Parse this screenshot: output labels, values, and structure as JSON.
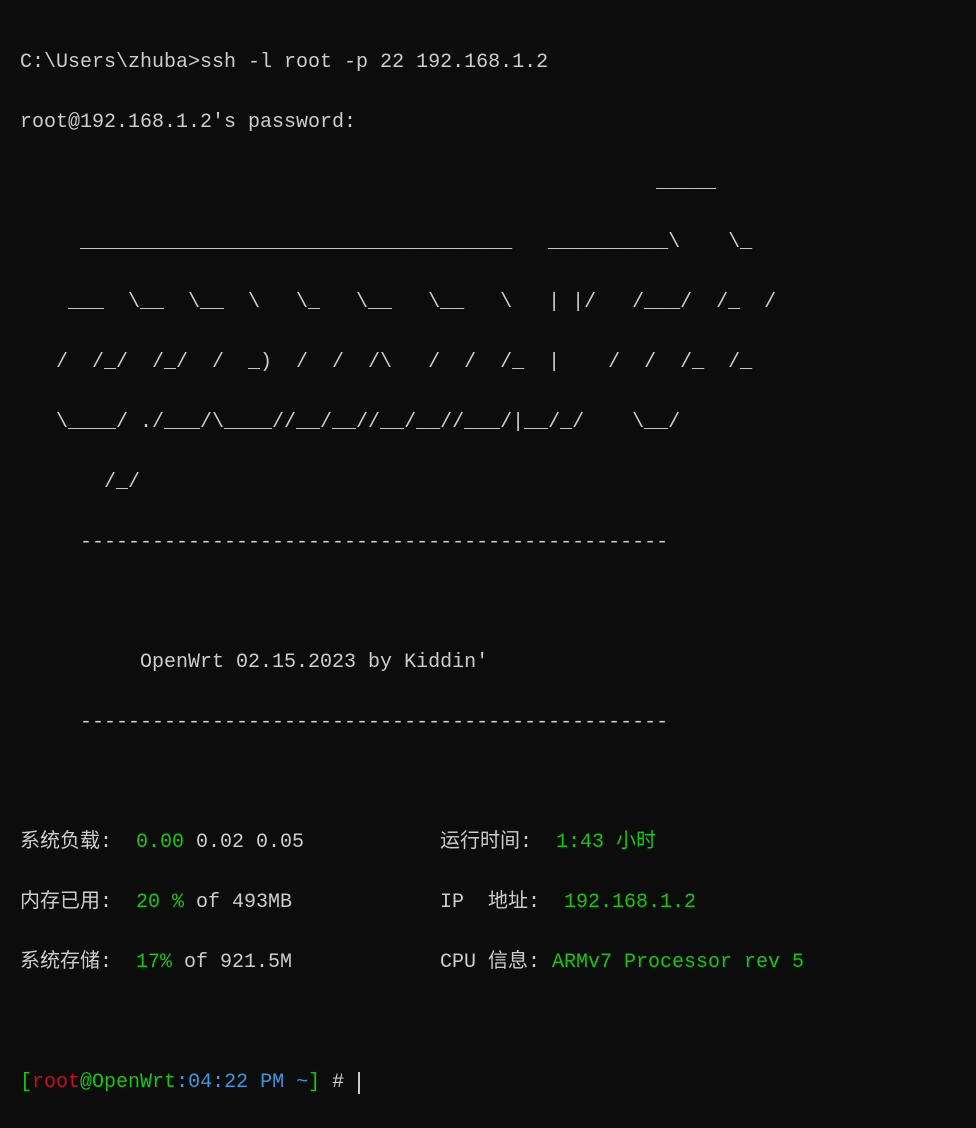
{
  "command_line": {
    "prompt_path": "C:\\Users\\zhuba>",
    "command": "ssh -l root -p 22 192.168.1.2"
  },
  "password_prompt": "root@192.168.1.2's password:",
  "ascii_art": {
    "line1": "                                                     _____",
    "line2": "     ____________________________________   __________\\    \\_",
    "line3": "    ___  \\__  \\__  \\   \\_   \\__   \\__   \\   | |/   /___/  /_  /",
    "line4": "   /  /_/  /_/  /  _)  /  /  /\\   /  /  /_  |    /  /  /_  /_",
    "line5": "   \\____/ ./___/\\____//__/__//__/__//___/|__/_/    \\__/",
    "line6": "       /_/",
    "divider1": "     -------------------------------------------------",
    "version_line": "          OpenWrt 02.15.2023 by Kiddin'",
    "divider2": "     -------------------------------------------------"
  },
  "stats": {
    "sys_load": {
      "label": "系统负载:  ",
      "value1": "0.00",
      "value2": " 0.02 0.05"
    },
    "uptime": {
      "label": "运行时间:  ",
      "value": "1:43 小时"
    },
    "memory": {
      "label": "内存已用:  ",
      "percent": "20 %",
      "of": " of 493MB"
    },
    "ip": {
      "label": "IP  地址:  ",
      "value": "192.168.1.2"
    },
    "storage": {
      "label": "系统存储:  ",
      "percent": "17%",
      "of": " of 921.5M"
    },
    "cpu": {
      "label": "CPU 信息: ",
      "value": "ARMv7 Processor rev 5"
    }
  },
  "shell_prompt": {
    "bracket_open": "[",
    "user": "root",
    "at": "@",
    "host": "OpenWrt",
    "colon": ":",
    "time": "04:22 PM",
    "tilde": " ~",
    "bracket_close": "]",
    "hash": " # "
  }
}
